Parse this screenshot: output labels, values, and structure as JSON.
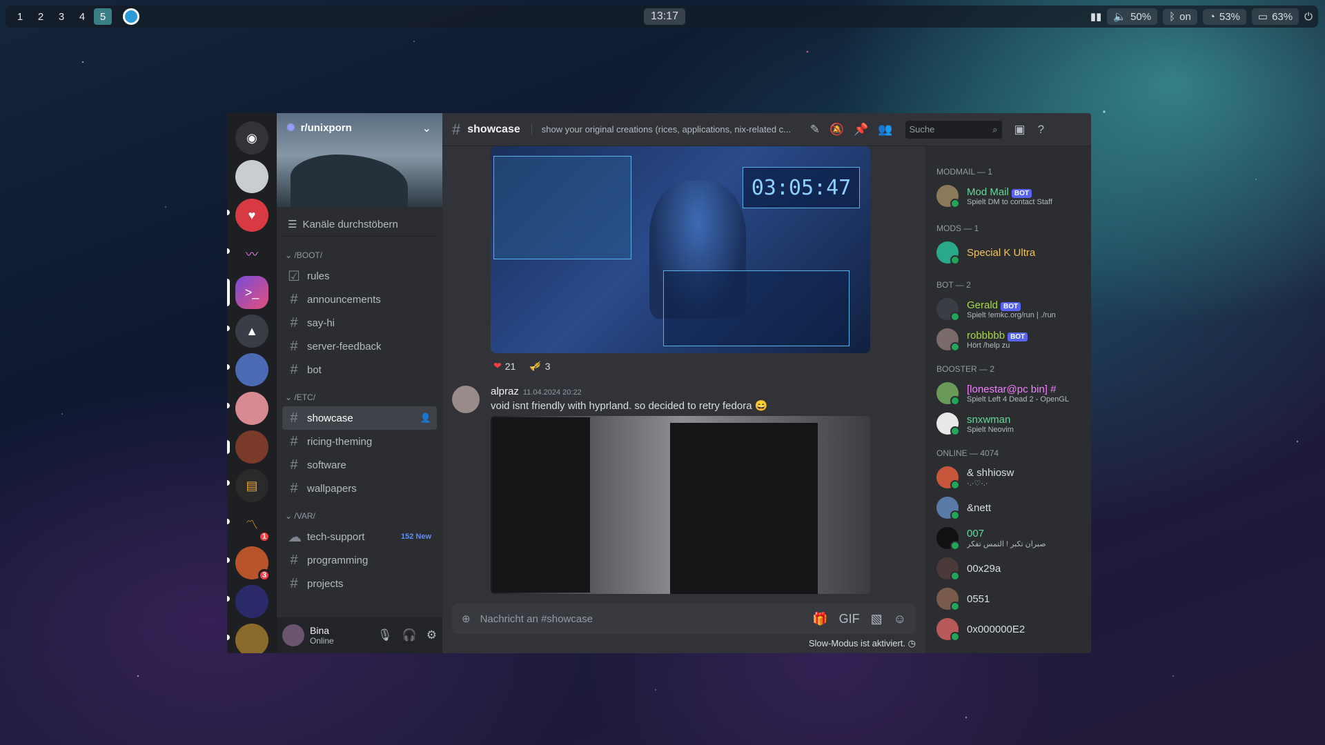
{
  "topbar": {
    "workspaces": [
      "1",
      "2",
      "3",
      "4",
      "5"
    ],
    "active_workspace": "5",
    "clock": "13:17",
    "volume": "50%",
    "bluetooth": "on",
    "wifi": "53%",
    "battery": "63%"
  },
  "server": {
    "name": "r/unixporn",
    "browse_label": "Kanäle durchstöbern"
  },
  "categories": {
    "boot": "/BOOT/",
    "etc": "/ETC/",
    "var": "/VAR/"
  },
  "channels": {
    "rules": "rules",
    "announcements": "announcements",
    "say_hi": "say-hi",
    "server_feedback": "server-feedback",
    "bot": "bot",
    "showcase": "showcase",
    "ricing": "ricing-theming",
    "software": "software",
    "wallpapers": "wallpapers",
    "tech_support": "tech-support",
    "tech_support_new": "152 New",
    "programming": "programming",
    "projects": "projects"
  },
  "user": {
    "name": "Bina",
    "status": "Online"
  },
  "guild_badges": {
    "g1": "1",
    "g2": "3"
  },
  "header": {
    "channel": "showcase",
    "topic": "show your original creations (rices, applications, nix-related c...",
    "search_placeholder": "Suche"
  },
  "messages": {
    "reactions": [
      {
        "emoji": "❤",
        "count": "21"
      },
      {
        "emoji": "🎺",
        "count": "3"
      }
    ],
    "image_clock": "03:05:47",
    "author": "alpraz",
    "timestamp": "11.04.2024 20:22",
    "text": "void isnt friendly with hyprland. so decided to retry fedora 😄"
  },
  "composer": {
    "placeholder": "Nachricht an #showcase",
    "slow_mode": "Slow-Modus ist aktiviert."
  },
  "members": {
    "modmail_cat": "MODMAIL — 1",
    "modmail_name": "Mod Mail",
    "modmail_sub": "Spielt DM to contact Staff",
    "mods_cat": "MODS — 1",
    "mods_name": "Special K Ultra",
    "bot_cat": "BOT — 2",
    "gerald": "Gerald",
    "gerald_sub": "Spielt !emkc.org/run | ./run",
    "robbbbb": "robbbbb",
    "robbbbb_sub": "Hört /help zu",
    "booster_cat": "BOOSTER — 2",
    "lonestar": "[lonestar@pc bin] #",
    "lonestar_sub": "Spielt Left 4 Dead 2 - OpenGL",
    "snxwman": "snxwman",
    "snxwman_sub": "Spielt Neovim",
    "online_cat": "ONLINE — 4074",
    "shhiosw": "& shhiosw",
    "shhiosw_sub": "·.·♡·.·",
    "nett": "&nett",
    "o07": "007",
    "o07_sub": "صبران تكبر ! التمس تفكر",
    "z29": "00x29a",
    "o551": "0551",
    "oxe2": "0x000000E2",
    "bot_label": "BOT"
  },
  "colors": {
    "accent": "#5865f2",
    "online": "#23a55a",
    "mention": "#f23f43"
  }
}
